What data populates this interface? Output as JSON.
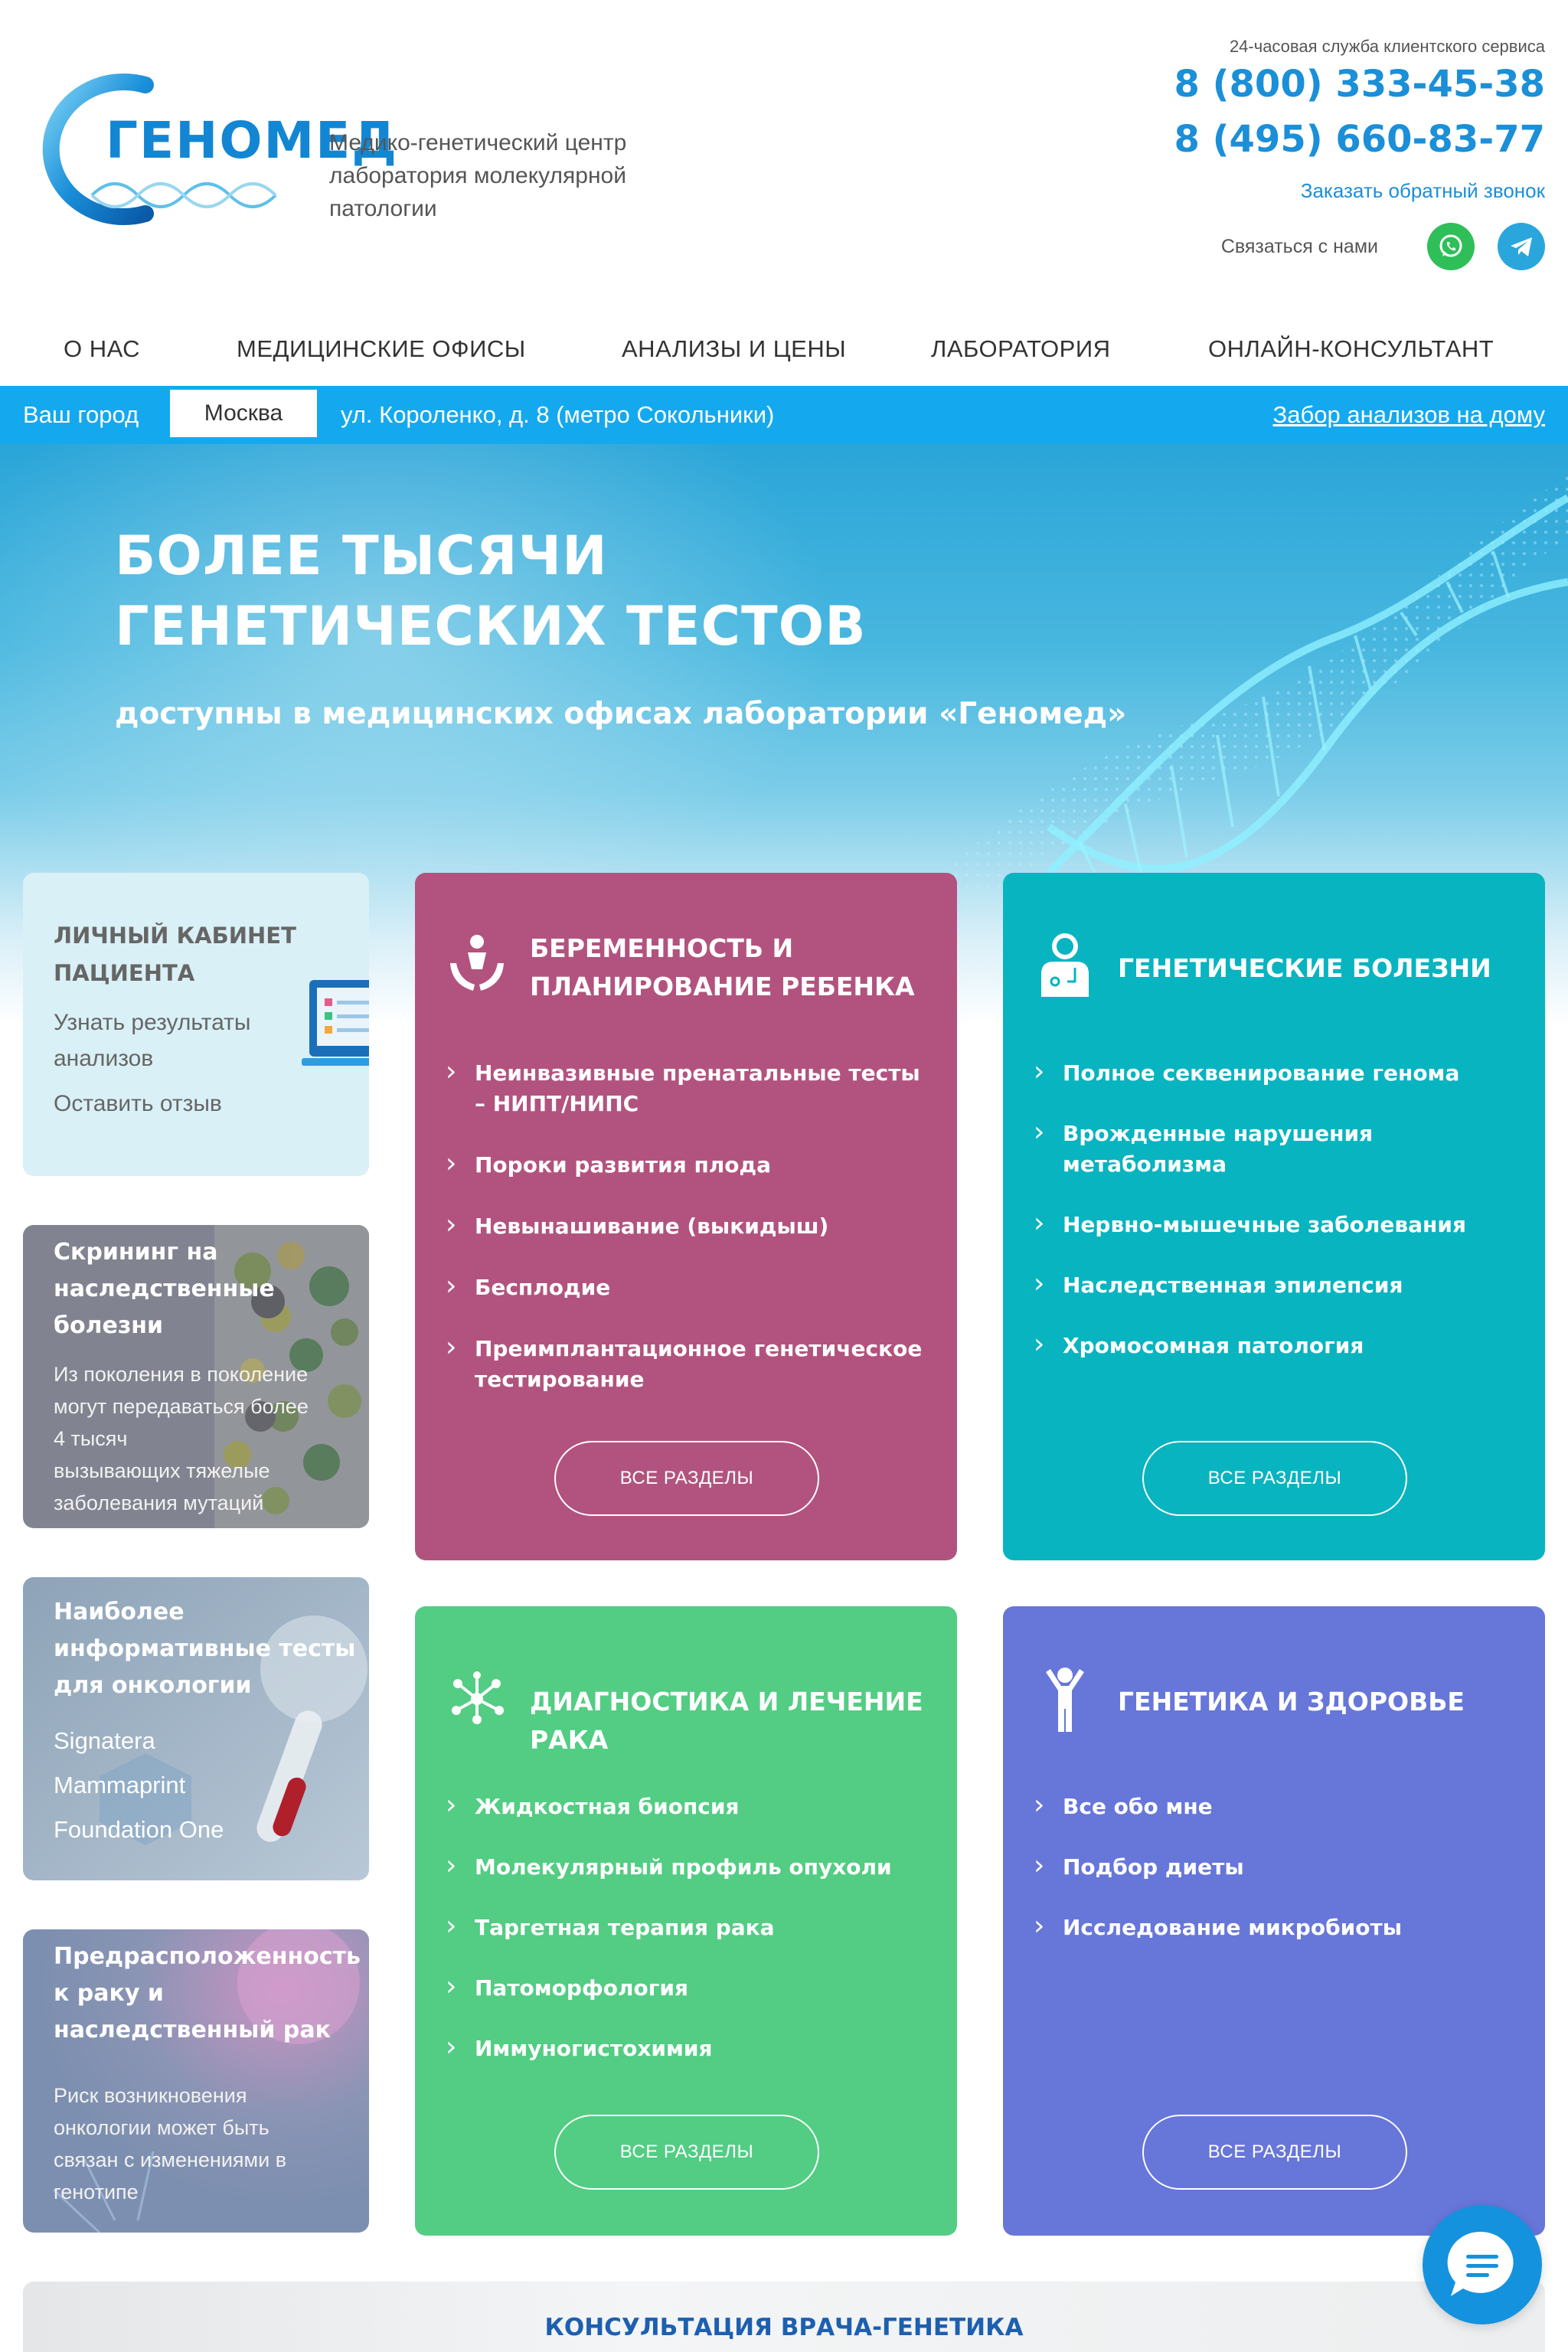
{
  "header": {
    "logo_text": "ГЕНОМЕД",
    "tagline": "Медико-генетический центр лаборатория молекулярной патологии",
    "service_note": "24-часовая служба клиентского сервиса",
    "phone1": "8 (800) 333-45-38",
    "phone2": "8 (495) 660-83-77",
    "callback": "Заказать обратный звонок",
    "contact_label": "Связаться с нами",
    "icons": [
      "whatsapp-icon",
      "telegram-icon"
    ]
  },
  "nav": {
    "items": [
      "О НАС",
      "МЕДИЦИНСКИЕ ОФИСЫ",
      "АНАЛИЗЫ И ЦЕНЫ",
      "ЛАБОРАТОРИЯ",
      "ОНЛАЙН-КОНСУЛЬТАНТ"
    ]
  },
  "citybar": {
    "label": "Ваш город",
    "city": "Москва",
    "address": "ул. Короленко, д. 8 (метро Сокольники)",
    "home_link": "Забор анализов на дому"
  },
  "hero": {
    "title_line1": "БОЛЕЕ ТЫСЯЧИ",
    "title_line2": "ГЕНЕТИЧЕСКИХ ТЕСТОВ",
    "subtitle": "доступны в медицинских офисах лаборатории «Геномед»"
  },
  "left_cards": {
    "account": {
      "title_line1": "ЛИЧНЫЙ КАБИНЕТ",
      "title_line2": "ПАЦИЕНТА",
      "link1_line1": "Узнать результаты",
      "link1_line2": "анализов",
      "link2": "Оставить отзыв"
    },
    "screening": {
      "title_line1": "Скрининг на",
      "title_line2": "наследственные",
      "title_line3": "болезни",
      "text_line1": "Из поколения в поколение",
      "text_line2": "могут передаваться более",
      "text_line3": "4 тысяч",
      "text_line4": "вызывающих тяжелые",
      "text_line5": "заболевания мутаций"
    },
    "oncology": {
      "title_line1": "Наиболее",
      "title_line2": "информативные тесты",
      "title_line3": "для онкологии",
      "items": [
        "Signatera",
        "Mammaprint",
        "Foundation One"
      ]
    },
    "predisposition": {
      "title_line1": "Предрасположенность",
      "title_line2": "к раку и",
      "title_line3": "наследственный рак",
      "text_line1": "Риск возникновения",
      "text_line2": "онкологии может быть",
      "text_line3": "связан с изменениями в",
      "text_line4": "генотипе"
    }
  },
  "categories": {
    "pregnancy": {
      "title_line1": "БЕРЕМЕННОСТЬ И",
      "title_line2": "ПЛАНИРОВАНИЕ РЕБЕНКА",
      "items": [
        "Неинвазивные пренатальные тесты – НИПТ/НИПС",
        "Пороки развития плода",
        "Невынашивание (выкидыш)",
        "Бесплодие",
        "Преимплантационное генетическое тестирование"
      ],
      "button": "ВСЕ РАЗДЕЛЫ",
      "color": "#b2537f"
    },
    "genetic": {
      "title": "ГЕНЕТИЧЕСКИЕ БОЛЕЗНИ",
      "items": [
        "Полное секвенирование генома",
        "Врожденные нарушения метаболизма",
        "Нервно-мышечные заболевания",
        "Наследственная эпилепсия",
        "Хромосомная патология"
      ],
      "button": "ВСЕ РАЗДЕЛЫ",
      "color": "#08b4c0"
    },
    "cancer": {
      "title": "ДИАГНОСТИКА И ЛЕЧЕНИЕ РАКА",
      "items": [
        "Жидкостная биопсия",
        "Молекулярный профиль опухоли",
        "Таргетная терапия рака",
        "Патоморфология",
        "Иммуногистохимия"
      ],
      "button": "ВСЕ РАЗДЕЛЫ",
      "color": "#52cd83"
    },
    "health": {
      "title": "ГЕНЕТИКА И ЗДОРОВЬЕ",
      "items": [
        "Все обо мне",
        "Подбор диеты",
        "Исследование микробиоты"
      ],
      "button": "ВСЕ РАЗДЕЛЫ",
      "color": "#6776d9"
    }
  },
  "consult": {
    "title": "КОНСУЛЬТАЦИЯ ВРАЧА-ГЕНЕТИКА"
  },
  "colors": {
    "brand_blue": "#1b8fd8",
    "citybar": "#14a9ef"
  }
}
